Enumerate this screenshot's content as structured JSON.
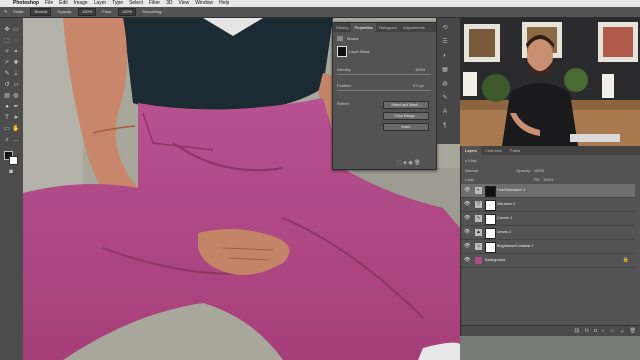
{
  "menubar": {
    "app": "Photoshop",
    "items": [
      "File",
      "Edit",
      "Image",
      "Layer",
      "Type",
      "Select",
      "Filter",
      "3D",
      "View",
      "Window",
      "Help"
    ]
  },
  "options": {
    "mode_label": "Mode:",
    "mode_value": "Normal",
    "opacity_label": "Opacity:",
    "opacity_value": "100%",
    "flow_label": "Flow:",
    "flow_value": "100%",
    "smoothing_label": "Smoothing:"
  },
  "properties": {
    "tabs": [
      "History",
      "Properties",
      "Histogram",
      "Adjustments"
    ],
    "section": "Masks",
    "layer_mask_label": "Layer Mask",
    "density_label": "Density:",
    "density_value": "100%",
    "feather_label": "Feather:",
    "feather_value": "0.0 px",
    "refine_label": "Refine:",
    "select_mask_btn": "Select and Mask...",
    "color_range_btn": "Color Range...",
    "invert_btn": "Invert"
  },
  "layers": {
    "tabs": [
      "Layers",
      "Channels",
      "Paths"
    ],
    "filter_label": "Kind",
    "blend_mode": "Normal",
    "opacity_label": "Opacity:",
    "opacity_value": "100%",
    "lock_label": "Lock:",
    "fill_label": "Fill:",
    "fill_value": "100%",
    "items": [
      {
        "name": "Hue/Saturation 1",
        "icon": "hue-sat-icon"
      },
      {
        "name": "Vibrance 1",
        "icon": "vibrance-icon"
      },
      {
        "name": "Curves 1",
        "icon": "curves-icon"
      },
      {
        "name": "Levels 1",
        "icon": "levels-icon"
      },
      {
        "name": "Brightness/Contrast 1",
        "icon": "brightness-icon"
      },
      {
        "name": "Background",
        "icon": "image-thumbnail"
      }
    ]
  },
  "colors": {
    "pants": "#b04a83",
    "ui_panel": "#535353",
    "selected_row": "#6e6e6e"
  }
}
